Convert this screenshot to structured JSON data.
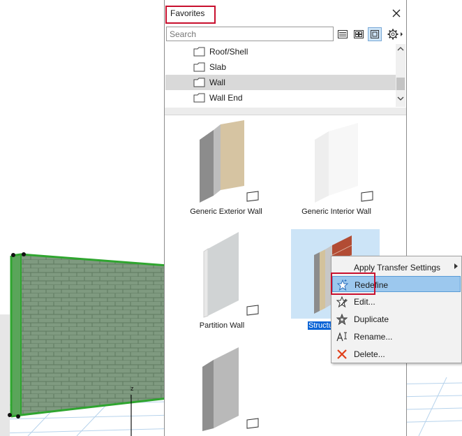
{
  "panel": {
    "title": "Favorites",
    "search_placeholder": "Search",
    "view_buttons": [
      "list-view-icon",
      "grid-view-icon",
      "preview-view-icon",
      "settings-gear-icon"
    ]
  },
  "folders": [
    {
      "label": "Roof/Shell",
      "selected": false
    },
    {
      "label": "Slab",
      "selected": false
    },
    {
      "label": "Wall",
      "selected": true
    },
    {
      "label": "Wall End",
      "selected": false
    }
  ],
  "tiles": [
    {
      "label": "Generic Exterior Wall",
      "selected": false
    },
    {
      "label": "Generic Interior Wall",
      "selected": false
    },
    {
      "label": "Partition Wall",
      "selected": false
    },
    {
      "label": "Structu",
      "selected": true
    },
    {
      "label": "",
      "selected": false
    }
  ],
  "context_menu": {
    "items": [
      {
        "label": "Apply Transfer Settings",
        "icon": "",
        "submenu": true
      },
      {
        "label": "Redefine",
        "icon": "star-redefine-icon",
        "hover": true
      },
      {
        "label": "Edit...",
        "icon": "star-edit-icon"
      },
      {
        "label": "Duplicate",
        "icon": "star-duplicate-icon"
      },
      {
        "label": "Rename...",
        "icon": "rename-icon"
      },
      {
        "label": "Delete...",
        "icon": "delete-x-icon"
      }
    ]
  },
  "viewport": {
    "axis_label": "z"
  },
  "colors": {
    "highlight_red": "#c8102e",
    "selection_blue": "#0a64d6",
    "menu_hover": "#9cc8ee",
    "wall_green": "#3fa83f"
  }
}
